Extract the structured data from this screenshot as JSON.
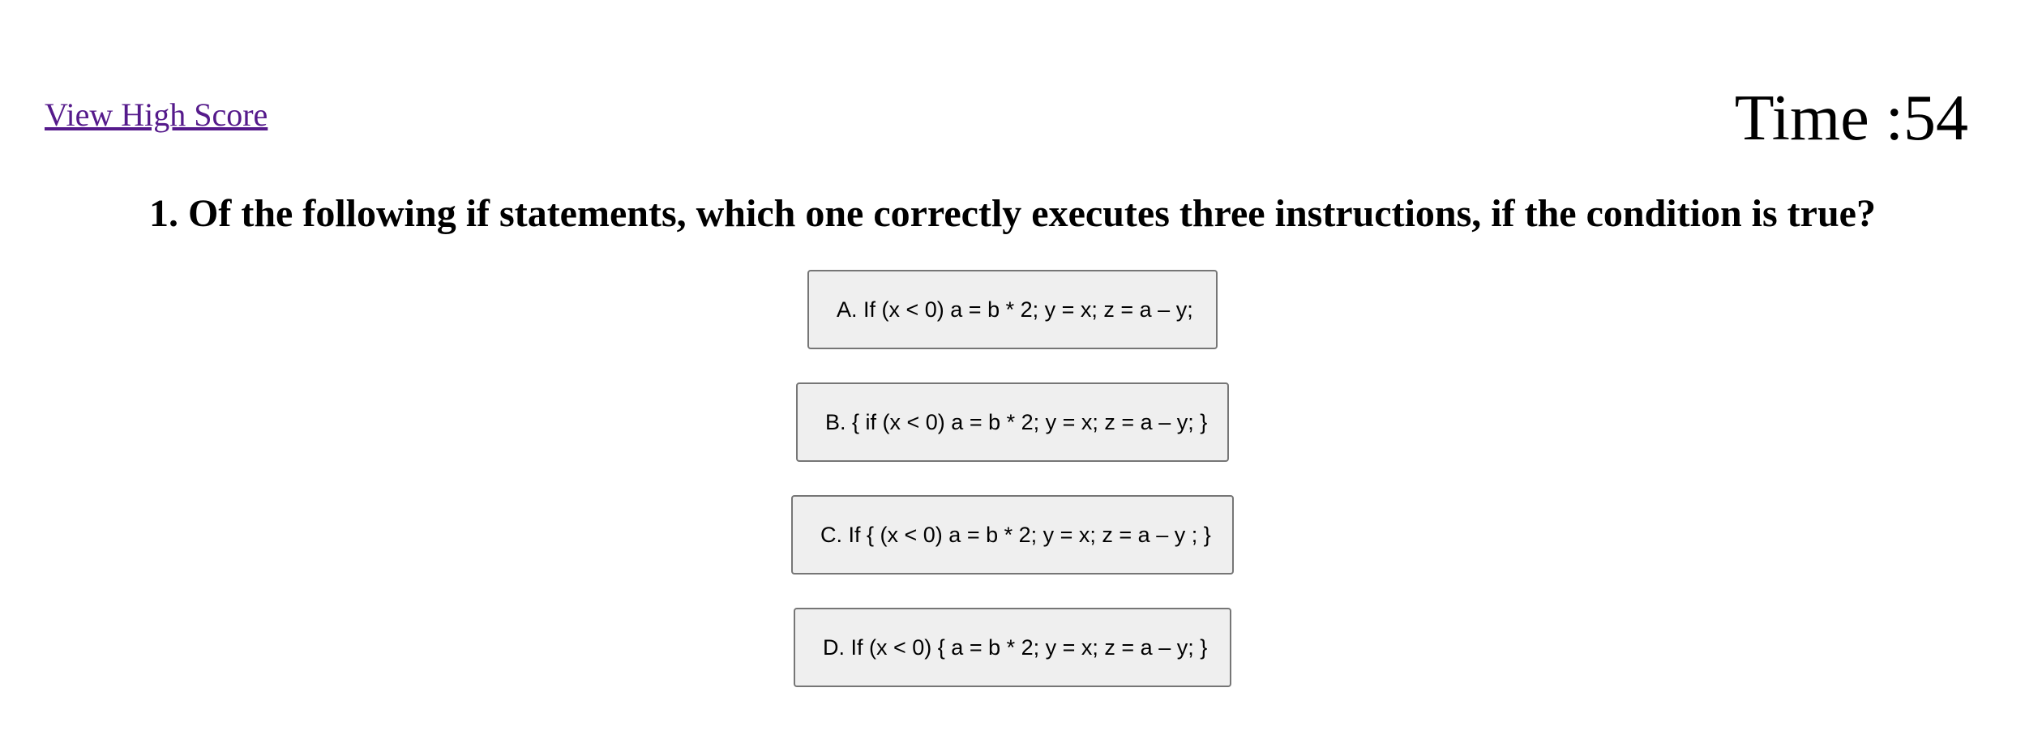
{
  "header": {
    "high_score_link": "View High Score",
    "timer": "Time :54"
  },
  "question": {
    "text": "1. Of the following if statements, which one correctly executes three instructions, if the condition is true?"
  },
  "answers": [
    {
      "label": "A. If (x < 0) a = b * 2; y = x; z = a – y;"
    },
    {
      "label": "B. { if (x < 0) a = b * 2; y = x; z = a – y; }"
    },
    {
      "label": "C. If { (x < 0) a = b * 2; y = x; z = a – y ; }"
    },
    {
      "label": "D. If (x < 0) { a = b * 2; y = x; z = a – y; }"
    }
  ]
}
